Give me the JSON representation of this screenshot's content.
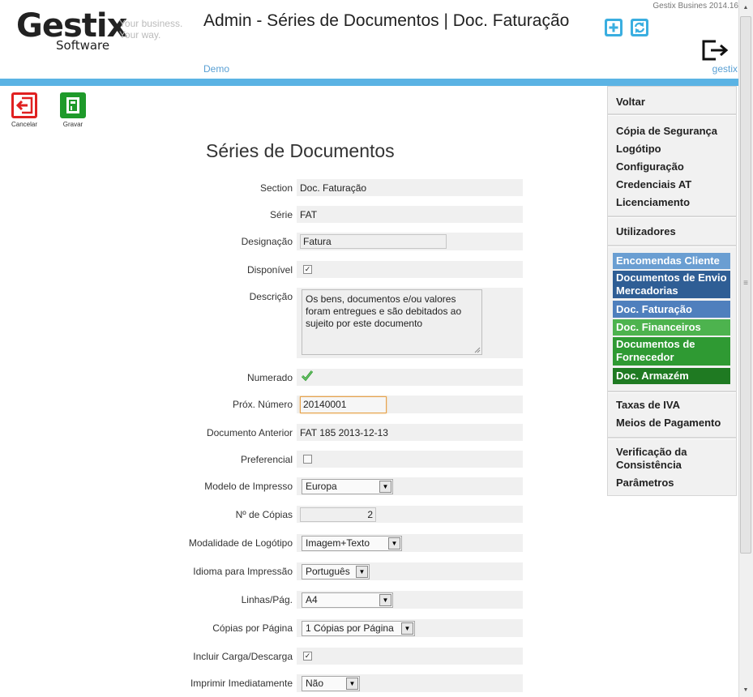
{
  "header": {
    "logo_main": "Gestix",
    "logo_sub": "Software",
    "tagline_1": "Your business.",
    "tagline_2": "Your way.",
    "title": "Admin - Séries de Documentos | Doc. Faturação",
    "version": "Gestix Busines 2014.16",
    "company_link": "Demo",
    "user_link": "gestix",
    "icons": [
      "add-icon",
      "refresh-icon",
      "logout-icon"
    ]
  },
  "toolbar": {
    "cancel_label": "Cancelar",
    "save_label": "Gravar"
  },
  "form": {
    "title": "Séries de Documentos",
    "section": {
      "label": "Section",
      "value": "Doc. Faturação"
    },
    "serie": {
      "label": "Série",
      "value": "FAT"
    },
    "designacao": {
      "label": "Designação",
      "value": "Fatura"
    },
    "disponivel": {
      "label": "Disponível",
      "checked": true
    },
    "descricao": {
      "label": "Descrição",
      "value": "Os bens, documentos e/ou valores foram entregues e são debitados ao sujeito por este documento"
    },
    "numerado": {
      "label": "Numerado",
      "checked": true
    },
    "prox_numero": {
      "label": "Próx. Número",
      "value": "20140001"
    },
    "doc_anterior": {
      "label": "Documento Anterior",
      "value": "FAT 185 2013-12-13"
    },
    "preferencial": {
      "label": "Preferencial",
      "checked": false
    },
    "modelo_impresso": {
      "label": "Modelo de Impresso",
      "value": "Europa"
    },
    "num_copias": {
      "label": "Nº de Cópias",
      "value": "2"
    },
    "modalidade_logotipo": {
      "label": "Modalidade de Logótipo",
      "value": "Imagem+Texto"
    },
    "idioma_impressao": {
      "label": "Idioma para Impressão",
      "value": "Português"
    },
    "linhas_pag": {
      "label": "Linhas/Pág.",
      "value": "A4"
    },
    "copias_pagina": {
      "label": "Cópias por Página",
      "value": "1 Cópias por Página"
    },
    "incluir_carga": {
      "label": "Incluir Carga/Descarga",
      "checked": true
    },
    "imprimir_imediat": {
      "label": "Imprimir Imediatamente",
      "value": "Não"
    }
  },
  "sidebar": {
    "voltar": "Voltar",
    "copia_seguranca": "Cópia de Segurança",
    "logotipo": "Logótipo",
    "configuracao": "Configuração",
    "credenciais": "Credenciais AT",
    "licenciamento": "Licenciamento",
    "utilizadores": "Utilizadores",
    "encomendas": "Encomendas Cliente",
    "envio_1": "Documentos de Envio",
    "envio_2": "Mercadorias",
    "faturacao": "Doc. Faturação",
    "financeiros": "Doc. Financeiros",
    "fornecedor_1": "Documentos de",
    "fornecedor_2": "Fornecedor",
    "armazem": "Doc. Armazém",
    "taxas_iva": "Taxas de IVA",
    "meios_pagamento": "Meios de Pagamento",
    "verificacao_1": "Verificação da",
    "verificacao_2": "Consistência",
    "parametros": "Parâmetros"
  },
  "colors": {
    "accent_bar": "#5bb3e4",
    "encomendas": "#6a9ed2",
    "envio": "#2f5e95",
    "faturacao": "#4f7fbd",
    "financeiros": "#4db34e",
    "fornecedor": "#2f9a33",
    "armazem": "#1f7a22"
  }
}
